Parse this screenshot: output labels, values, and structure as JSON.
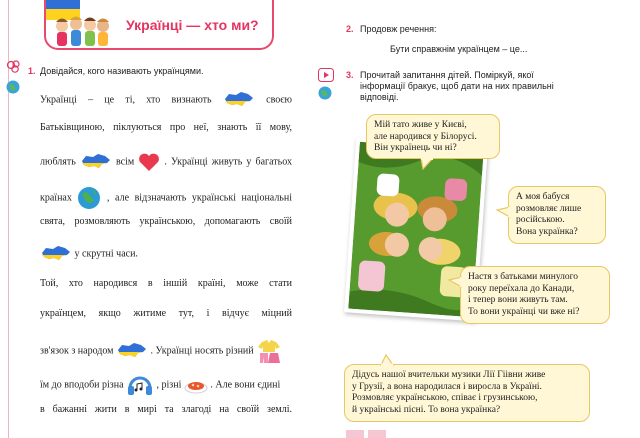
{
  "header": {
    "title": "Українці — хто ми?"
  },
  "task1": {
    "number": "1.",
    "prompt": "Довідайся, кого називають українцями.",
    "lines": [
      {
        "a": "Українці – це ті, хто визнають",
        "b": "своєю"
      },
      {
        "a": "Батьківщиною, піклуються про неї, знають її мову,"
      },
      {
        "a": "люблять",
        "b": "всім",
        "c": ". Українці живуть у багатьох"
      },
      {
        "a": "країнах",
        "b": ", але відзначають українські національні"
      },
      {
        "a": "свята, розмовляють українською, допомагають своїй"
      },
      {
        "a": "у скрутні часи."
      },
      {
        "a": "Той, хто народився в іншій країні, може стати"
      },
      {
        "a": "українцем, якщо житиме тут, і відчує міцний"
      },
      {
        "a": "зв'язок з народом",
        "b": ". Українці носять різний"
      },
      {
        "a": "їм до вподоби різна",
        "b": ", різні",
        "c": ". Але вони єдині"
      },
      {
        "a": "в бажанні жити в мирі та злагоді на своїй землі."
      }
    ]
  },
  "task2": {
    "number": "2.",
    "prompt": "Продовж речення:",
    "sentence": "Бути справжнім українцем – це..."
  },
  "task3": {
    "number": "3.",
    "prompt_line1": "Прочитай запитання дітей. Поміркуй, якої",
    "prompt_line2": "інформації бракує, щоб дати на них правильні",
    "prompt_line3": "відповіді."
  },
  "bubbles": {
    "b1": [
      "Мій тато живе у Києві,",
      "але народився у Білорусі.",
      "Він українець чи ні?"
    ],
    "b2": [
      "А моя бабуся",
      "розмовляє лише",
      "російською.",
      "Вона українка?"
    ],
    "b3": [
      "Настя з батьками минулого",
      "року переїхала до Канади,",
      "і тепер вони живуть там.",
      "То вони українці чи вже ні?"
    ],
    "b4": [
      "Дідусь нашої вчительки музики Лії Гіівни живе",
      "у Грузії, а вона народилася і виросла в Україні.",
      "Розмовляє українською, співає і грузинською,",
      "й українські пісні. То вона українка?"
    ]
  },
  "colors": {
    "accent": "#e4345f",
    "bubble_bg": "#fff7d6",
    "bubble_border": "#e8c765"
  },
  "icons": [
    "ukraine-flag-icon",
    "kids-icon",
    "think-icon",
    "globe-icon",
    "ukraine-map-icon",
    "heart-icon",
    "globe-icon",
    "ukraine-map-icon",
    "ukraine-map-icon",
    "clothes-icon",
    "headphones-icon",
    "food-icon",
    "video-icon"
  ]
}
